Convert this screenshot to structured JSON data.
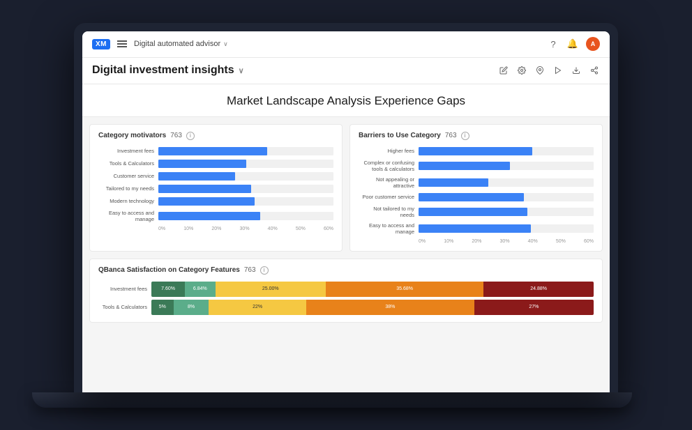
{
  "nav": {
    "logo": "XM",
    "app_title": "Digital automated advisor",
    "chevron": "∨",
    "help_icon": "?",
    "bell_icon": "🔔",
    "avatar_initials": "A"
  },
  "secondary_nav": {
    "page_title": "Digital investment insights",
    "chevron": "∨"
  },
  "toolbar": {
    "icons": [
      "edit",
      "settings",
      "pin",
      "play",
      "download",
      "share"
    ]
  },
  "dashboard": {
    "title": "Market Landscape Analysis Experience Gaps",
    "chart_left": {
      "title": "Category motivators",
      "count": "763",
      "bars": [
        {
          "label": "Investment fees",
          "pct": 62
        },
        {
          "label": "Tools & Calculators",
          "pct": 50
        },
        {
          "label": "Customer service",
          "pct": 44
        },
        {
          "label": "Tailored to my needs",
          "pct": 53
        },
        {
          "label": "Modern technology",
          "pct": 55
        },
        {
          "label": "Easy to access and manage",
          "pct": 58
        }
      ],
      "axis": [
        "0%",
        "10%",
        "20%",
        "30%",
        "40%",
        "50%",
        "60%"
      ]
    },
    "chart_right": {
      "title": "Barriers to Use Category",
      "count": "763",
      "bars": [
        {
          "label": "Higher fees",
          "pct": 65
        },
        {
          "label": "Complex or confusing tools & calculators",
          "pct": 52
        },
        {
          "label": "Not appealing or attractive",
          "pct": 40
        },
        {
          "label": "Poor customer service",
          "pct": 60
        },
        {
          "label": "Not tailored to my needs",
          "pct": 62
        },
        {
          "label": "Easy to access and manage",
          "pct": 64
        }
      ],
      "axis": [
        "0%",
        "10%",
        "20%",
        "30%",
        "40%",
        "50%",
        "60%"
      ]
    },
    "stacked_chart": {
      "title": "QBanca Satisfaction on Category Features",
      "count": "763",
      "rows": [
        {
          "label": "Investment fees",
          "segments": [
            {
              "color": "#3B7A57",
              "pct": 7.6,
              "label": "7.60%"
            },
            {
              "color": "#5BAD8A",
              "pct": 6.84,
              "label": "6.84%"
            },
            {
              "color": "#F5C842",
              "pct": 25.0,
              "label": "25.00%"
            },
            {
              "color": "#F07A20",
              "pct": 35.68,
              "label": "35.68%"
            },
            {
              "color": "#8B1A1A",
              "pct": 24.88,
              "label": "24.88%"
            }
          ]
        },
        {
          "label": "Tools & Calculators",
          "segments": [
            {
              "color": "#3B7A57",
              "pct": 5,
              "label": "5%"
            },
            {
              "color": "#5BAD8A",
              "pct": 8,
              "label": "8%"
            },
            {
              "color": "#F5C842",
              "pct": 22,
              "label": "22%"
            },
            {
              "color": "#F07A20",
              "pct": 38,
              "label": "38%"
            },
            {
              "color": "#8B1A1A",
              "pct": 27,
              "label": "27%"
            }
          ]
        }
      ]
    }
  }
}
